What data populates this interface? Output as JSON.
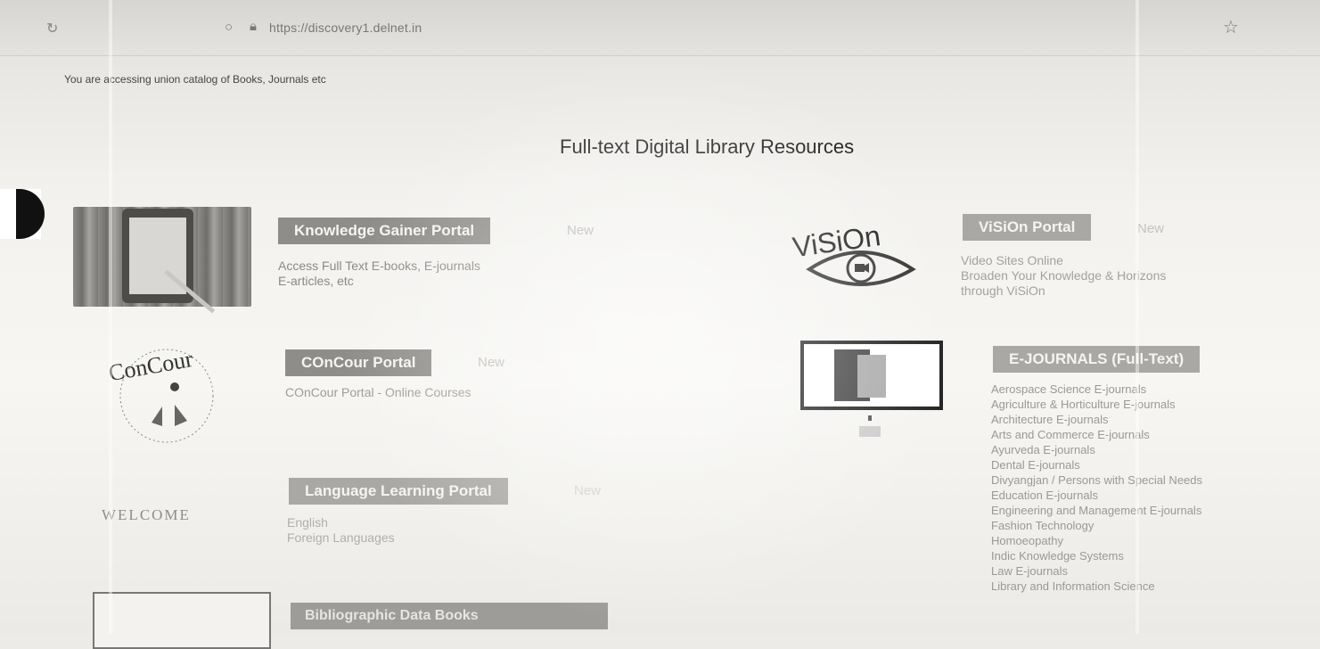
{
  "browser": {
    "url": "https://discovery1.delnet.in",
    "reload_icon": "reload-icon",
    "shield_icon": "shield-icon",
    "lock_icon": "lock-icon",
    "bookmark_icon": "star-icon"
  },
  "notice": "You are accessing union catalog of Books, Journals etc",
  "page_title": "Full-text Digital Library Resources",
  "portals": {
    "knowledge_gainer": {
      "label": "Knowledge Gainer Portal",
      "tag": "New",
      "desc_line1": "Access Full Text E-books, E-journals",
      "desc_line2": "E-articles, etc"
    },
    "vision": {
      "label": "ViSiOn Portal",
      "tag": "New",
      "logo_text": "ViSiOn",
      "desc_line1": "Video Sites Online",
      "desc_line2": "Broaden Your Knowledge & Horizons",
      "desc_line3": "through ViSiOn"
    },
    "concour": {
      "label": "COnCour Portal",
      "tag": "New",
      "logo_text": "ConCour",
      "desc_line1": "COnCour Portal - Online Courses"
    },
    "ejournals": {
      "label": "E-JOURNALS (Full-Text)",
      "items": [
        "Aerospace Science E-journals",
        "Agriculture & Horticulture E-journals",
        "Architecture E-journals",
        "Arts and Commerce E-journals",
        "Ayurveda E-journals",
        "Dental E-journals",
        "Divyangjan / Persons with Special Needs",
        "Education E-journals",
        "Engineering and Management E-journals",
        "Fashion Technology",
        "Homoeopathy",
        "Indic Knowledge Systems",
        "Law E-journals",
        "Library and Information Science"
      ]
    },
    "language": {
      "label": "Language Learning Portal",
      "tag": "New",
      "desc_line1": "English",
      "desc_line2": "Foreign Languages"
    },
    "bottom": {
      "label": "Bibliographic Data Books"
    }
  },
  "welcome_text": "WELCOME"
}
